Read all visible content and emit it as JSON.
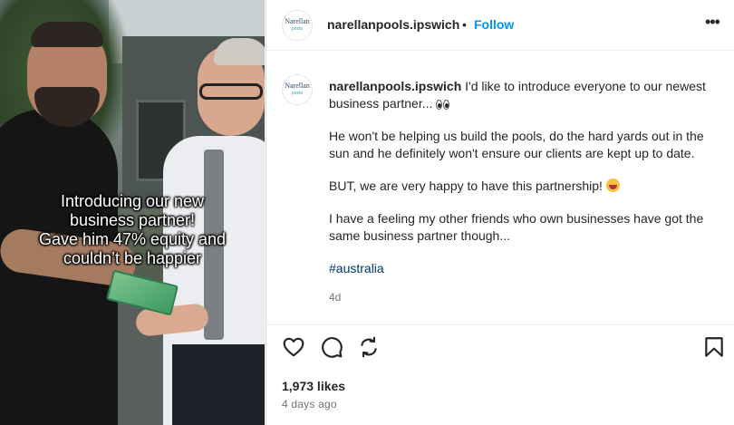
{
  "photo": {
    "overlay_lines": [
      "Introducing our new",
      "business partner!",
      "Gave him 47% equity and",
      "couldn’t be happier"
    ]
  },
  "header": {
    "avatar_logo": "Narellan",
    "avatar_logo_sub": "pools",
    "username": "narellanpools.ipswich",
    "separator": "•",
    "follow_label": "Follow",
    "more_icon": "more-options-icon"
  },
  "caption": {
    "avatar_logo": "Narellan",
    "avatar_logo_sub": "pools",
    "username": "narellanpools.ipswich",
    "line1": "I'd like to introduce everyone to our newest business partner...",
    "para2": "He won't be helping us build the pools, do the hard yards out in the sun and he definitely won't ensure our clients are kept up to date.",
    "para3": "BUT, we are very happy to have this partnership!",
    "para4": "I have a feeling my other friends who own businesses have got the same business partner though...",
    "hashtag": "#australia",
    "time": "4d"
  },
  "actions": {
    "icons": [
      "heart-icon",
      "comment-icon",
      "share-icon",
      "bookmark-icon"
    ],
    "likes": "1,973 likes",
    "posted": "4 days ago"
  },
  "colors": {
    "follow_blue": "#0095f6",
    "hashtag": "#00376b",
    "muted": "#737373",
    "text": "#262626"
  }
}
